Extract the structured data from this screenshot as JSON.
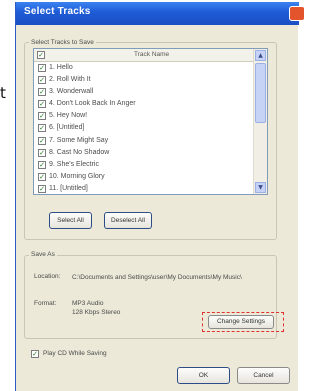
{
  "background_char": "t",
  "dialog": {
    "title": "Select Tracks",
    "select_group_label": "Select Tracks to Save",
    "column_header": "Track Name",
    "tracks": [
      {
        "label": "1. Hello",
        "checked": true
      },
      {
        "label": "2. Roll With It",
        "checked": true
      },
      {
        "label": "3. Wonderwall",
        "checked": true
      },
      {
        "label": "4. Don't Look Back In Anger",
        "checked": true
      },
      {
        "label": "5. Hey Now!",
        "checked": true
      },
      {
        "label": "6. [Untitled]",
        "checked": true
      },
      {
        "label": "7. Some Might Say",
        "checked": true
      },
      {
        "label": "8. Cast No Shadow",
        "checked": true
      },
      {
        "label": "9. She's Electric",
        "checked": true
      },
      {
        "label": "10. Morning Glory",
        "checked": true
      },
      {
        "label": "11. [Untitled]",
        "checked": true
      }
    ],
    "check_mark": "✓",
    "select_all_label": "Select All",
    "deselect_all_label": "Deselect All",
    "save_group_label": "Save As",
    "location_label": "Location:",
    "location_value": "C:\\Documents and Settings\\user\\My Documents\\My Music\\",
    "format_label": "Format:",
    "format_value": "MP3 Audio",
    "format_detail": "128 Kbps Stereo",
    "change_settings_label": "Change Settings",
    "play_cd_label": "Play CD While Saving",
    "play_cd_checked": true,
    "ok_label": "OK",
    "cancel_label": "Cancel"
  },
  "colors": {
    "titlebar": "#2a63de",
    "highlight_dash": "#e0312f"
  }
}
